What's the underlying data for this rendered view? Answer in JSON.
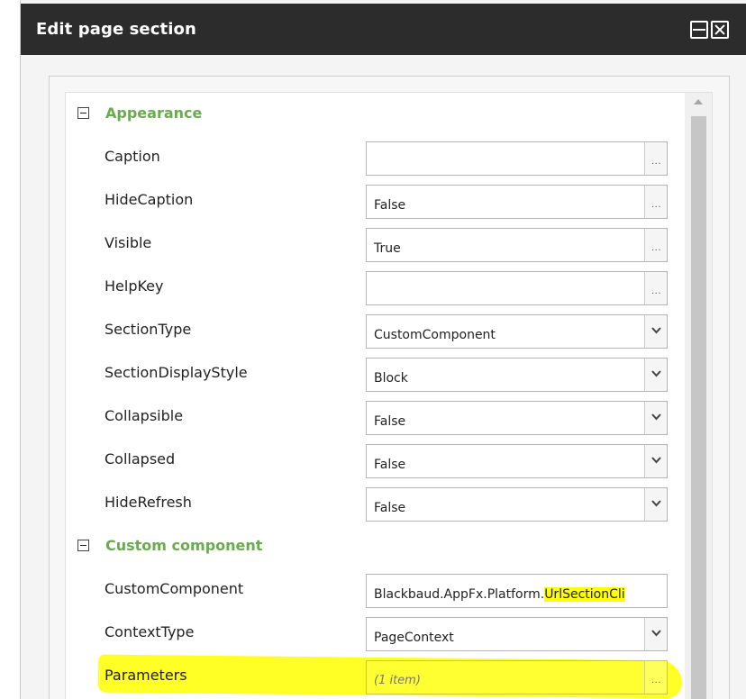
{
  "window": {
    "title": "Edit page section",
    "maximize_icon": "maximize-icon",
    "close_icon": "close-icon"
  },
  "categories": {
    "appearance": {
      "label": "Appearance",
      "color": "#6aab4f"
    },
    "custom_component": {
      "label": "Custom component",
      "color": "#6aab4f"
    }
  },
  "properties": {
    "caption": {
      "name": "Caption",
      "value": "",
      "editor": "ellipsis"
    },
    "hide_caption": {
      "name": "HideCaption",
      "value": "False",
      "editor": "ellipsis"
    },
    "visible": {
      "name": "Visible",
      "value": "True",
      "editor": "ellipsis"
    },
    "help_key": {
      "name": "HelpKey",
      "value": "",
      "editor": "ellipsis"
    },
    "section_type": {
      "name": "SectionType",
      "value": "CustomComponent",
      "editor": "dropdown"
    },
    "section_display_style": {
      "name": "SectionDisplayStyle",
      "value": "Block",
      "editor": "dropdown"
    },
    "collapsible": {
      "name": "Collapsible",
      "value": "False",
      "editor": "dropdown"
    },
    "collapsed": {
      "name": "Collapsed",
      "value": "False",
      "editor": "dropdown"
    },
    "hide_refresh": {
      "name": "HideRefresh",
      "value": "False",
      "editor": "dropdown"
    },
    "custom_component": {
      "name": "CustomComponent",
      "value_prefix": "Blackbaud.AppFx.Platform.",
      "value_highlighted": "UrlSectionCli",
      "editor": "text"
    },
    "context_type": {
      "name": "ContextType",
      "value": "PageContext",
      "editor": "dropdown"
    },
    "parameters": {
      "name": "Parameters",
      "value": "(1 item)",
      "editor": "ellipsis"
    }
  },
  "ellipsis_label": "...",
  "highlight_color": "#ffff00"
}
